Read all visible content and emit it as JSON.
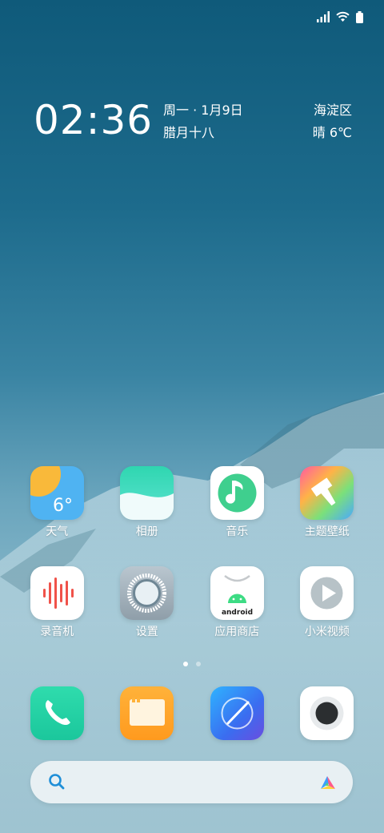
{
  "clock": {
    "time": "02:36",
    "weekday_date": "周一 · 1月9日",
    "lunar_date": "腊月十八"
  },
  "location": {
    "district": "海淀区",
    "weather": "晴  6℃"
  },
  "apps_row1": [
    {
      "label": "天气",
      "icon": "weather-icon",
      "badge_text": "6°"
    },
    {
      "label": "相册",
      "icon": "gallery-icon"
    },
    {
      "label": "音乐",
      "icon": "music-icon"
    },
    {
      "label": "主题壁纸",
      "icon": "themes-icon"
    }
  ],
  "apps_row2": [
    {
      "label": "录音机",
      "icon": "recorder-icon"
    },
    {
      "label": "设置",
      "icon": "settings-icon"
    },
    {
      "label": "应用商店",
      "icon": "app-store-icon",
      "badge_text": "android"
    },
    {
      "label": "小米视频",
      "icon": "video-icon"
    }
  ],
  "dock": [
    {
      "icon": "phone-icon"
    },
    {
      "icon": "messages-icon"
    },
    {
      "icon": "browser-icon"
    },
    {
      "icon": "camera-icon"
    }
  ],
  "page_indicator": {
    "pages": 2,
    "current": 1
  },
  "search": {
    "placeholder": ""
  },
  "colors": {
    "wallpaper_top": "#0f5a7a",
    "wallpaper_bottom": "#97bfcd",
    "search_bar": "#ecf2f4",
    "search_icon": "#1f8fd8"
  }
}
